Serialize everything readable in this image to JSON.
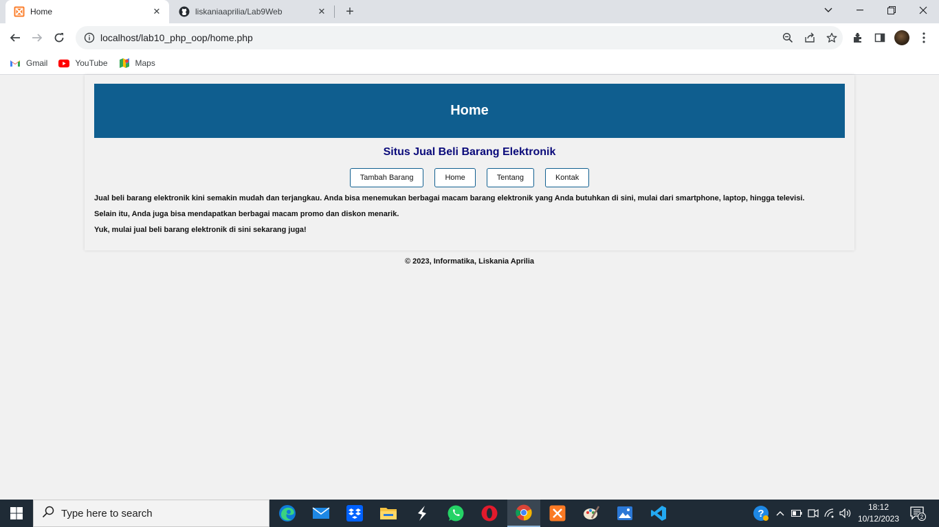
{
  "browser": {
    "tabs": [
      {
        "label": "Home",
        "favicon": "xampp-icon",
        "active": true
      },
      {
        "label": "liskaniaaprilia/Lab9Web",
        "favicon": "github-icon",
        "active": false
      }
    ],
    "url": "localhost/lab10_php_oop/home.php",
    "bookmarks": [
      {
        "label": "Gmail",
        "icon": "gmail-icon"
      },
      {
        "label": "YouTube",
        "icon": "youtube-icon"
      },
      {
        "label": "Maps",
        "icon": "maps-icon"
      }
    ]
  },
  "page": {
    "header_title": "Home",
    "subtitle": "Situs Jual Beli Barang Elektronik",
    "nav": [
      "Tambah Barang",
      "Home",
      "Tentang",
      "Kontak"
    ],
    "paragraphs": [
      "Jual beli barang elektronik kini semakin mudah dan terjangkau. Anda bisa menemukan berbagai macam barang elektronik yang Anda butuhkan di sini, mulai dari smartphone, laptop, hingga televisi.",
      "Selain itu, Anda juga bisa mendapatkan berbagai macam promo dan diskon menarik.",
      "Yuk, mulai jual beli barang elektronik di sini sekarang juga!"
    ],
    "footer": "© 2023, Informatika, Liskania Aprilia"
  },
  "taskbar": {
    "search_placeholder": "Type here to search",
    "time": "18:12",
    "date": "10/12/2023",
    "notification_count": "2"
  },
  "colors": {
    "header_bg": "#0f5e8f",
    "subtitle": "#0a0a7a",
    "taskbar_bg": "#1f2b36"
  }
}
